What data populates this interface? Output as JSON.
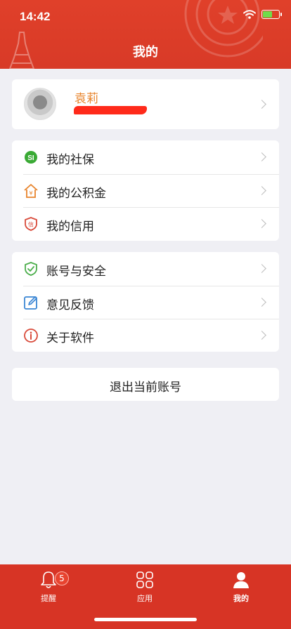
{
  "status": {
    "time": "14:42"
  },
  "header": {
    "title": "我的"
  },
  "profile": {
    "name": "袁莉"
  },
  "menu_group_1": [
    {
      "label": "我的社保",
      "icon": "social-security-icon"
    },
    {
      "label": "我的公积金",
      "icon": "housing-fund-icon"
    },
    {
      "label": "我的信用",
      "icon": "credit-shield-icon"
    }
  ],
  "menu_group_2": [
    {
      "label": "账号与安全",
      "icon": "shield-check-icon"
    },
    {
      "label": "意见反馈",
      "icon": "edit-icon"
    },
    {
      "label": "关于软件",
      "icon": "info-icon"
    }
  ],
  "logout": {
    "label": "退出当前账号"
  },
  "tabbar": {
    "items": [
      {
        "label": "提醒",
        "icon": "bell-icon",
        "badge": "5"
      },
      {
        "label": "应用",
        "icon": "apps-grid-icon"
      },
      {
        "label": "我的",
        "icon": "person-icon",
        "active": true
      }
    ]
  },
  "colors": {
    "header_red": "#d83a27",
    "tabbar_red": "#d73425",
    "name_orange": "#e8842c",
    "background": "#efeff4"
  }
}
